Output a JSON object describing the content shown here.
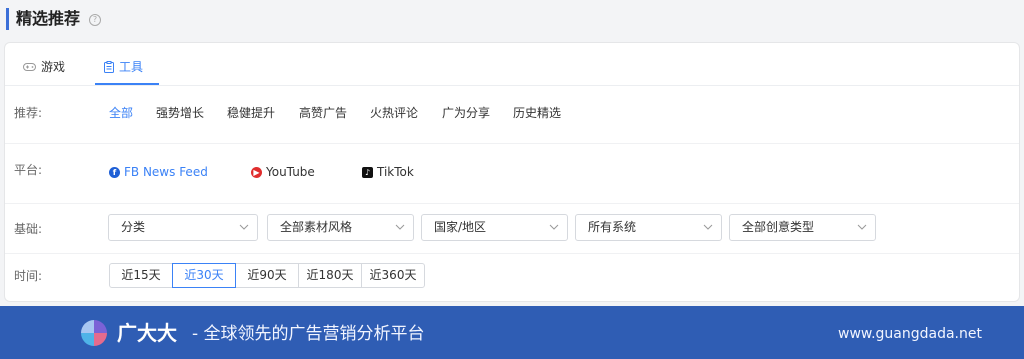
{
  "header": {
    "title": "精选推荐",
    "help_icon": "?"
  },
  "tabs": [
    {
      "label": "游戏",
      "icon": "gamepad-icon",
      "active": false
    },
    {
      "label": "工具",
      "icon": "clipboard-icon",
      "active": true
    }
  ],
  "filters": {
    "recommend": {
      "label": "推荐:",
      "options": [
        "全部",
        "强势增长",
        "稳健提升",
        "高赞广告",
        "火热评论",
        "广为分享",
        "历史精选"
      ],
      "selected": "全部"
    },
    "platform": {
      "label": "平台:",
      "options": [
        {
          "label": "FB News Feed",
          "icon": "facebook-icon",
          "active": true
        },
        {
          "label": "YouTube",
          "icon": "youtube-icon",
          "active": false
        },
        {
          "label": "TikTok",
          "icon": "tiktok-icon",
          "active": false
        }
      ]
    },
    "basic": {
      "label": "基础:",
      "selects": [
        "分类",
        "全部素材风格",
        "国家/地区",
        "所有系统",
        "全部创意类型"
      ]
    },
    "time": {
      "label": "时间:",
      "options": [
        "近15天",
        "近30天",
        "近90天",
        "近180天",
        "近360天"
      ],
      "selected": "近30天"
    }
  },
  "footer": {
    "brand": "广大大",
    "slogan": "- 全球领先的广告营销分析平台",
    "site": "www.guangdada.net"
  },
  "colors": {
    "accent": "#3b82f6",
    "footer_bg": "#2f5db4",
    "header_bar": "#3b6fd8"
  }
}
